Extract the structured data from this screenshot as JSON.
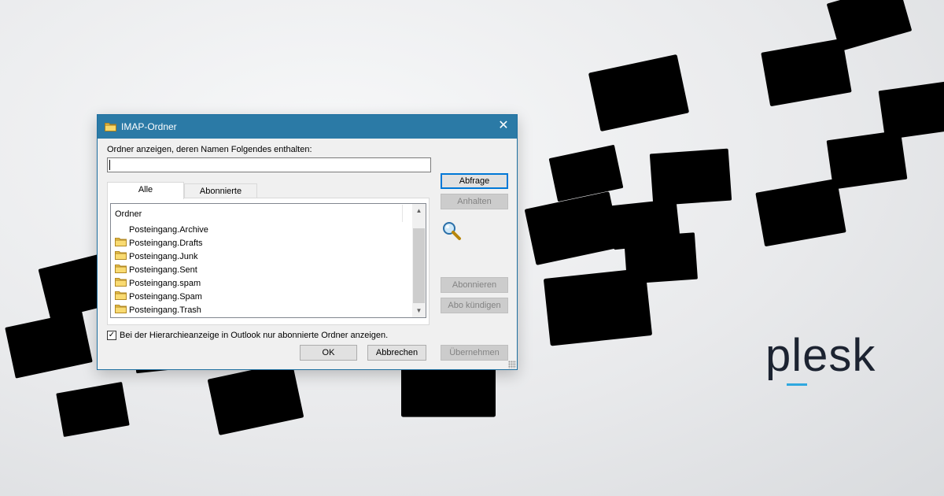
{
  "dialog": {
    "title": "IMAP-Ordner",
    "close_label": "✕",
    "filter_label": "Ordner anzeigen, deren Namen Folgendes enthalten:",
    "filter_value": "",
    "tabs": [
      {
        "label": "Alle",
        "active": true
      },
      {
        "label": "Abonnierte",
        "active": false
      }
    ],
    "list": {
      "header": "Ordner",
      "rows": [
        {
          "label": "Posteingang.Archive",
          "folder_icon": false
        },
        {
          "label": "Posteingang.Drafts",
          "folder_icon": true
        },
        {
          "label": "Posteingang.Junk",
          "folder_icon": true
        },
        {
          "label": "Posteingang.Sent",
          "folder_icon": true
        },
        {
          "label": "Posteingang.spam",
          "folder_icon": true
        },
        {
          "label": "Posteingang.Spam",
          "folder_icon": true
        },
        {
          "label": "Posteingang.Trash",
          "folder_icon": true
        }
      ]
    },
    "buttons": {
      "query": "Abfrage",
      "stop": "Anhalten",
      "subscribe": "Abonnieren",
      "unsubscribe": "Abo kündigen",
      "ok": "OK",
      "cancel": "Abbrechen",
      "apply": "Übernehmen"
    },
    "checkbox": {
      "checked": true,
      "label": "Bei der Hierarchieanzeige in Outlook nur abonnierte Ordner anzeigen."
    }
  },
  "brand": {
    "logo_text": "plesk",
    "accent_color": "#2fa8df",
    "text_color": "#1c2331"
  },
  "colors": {
    "titlebar": "#2b7aa6",
    "default_button_border": "#0078d7"
  }
}
